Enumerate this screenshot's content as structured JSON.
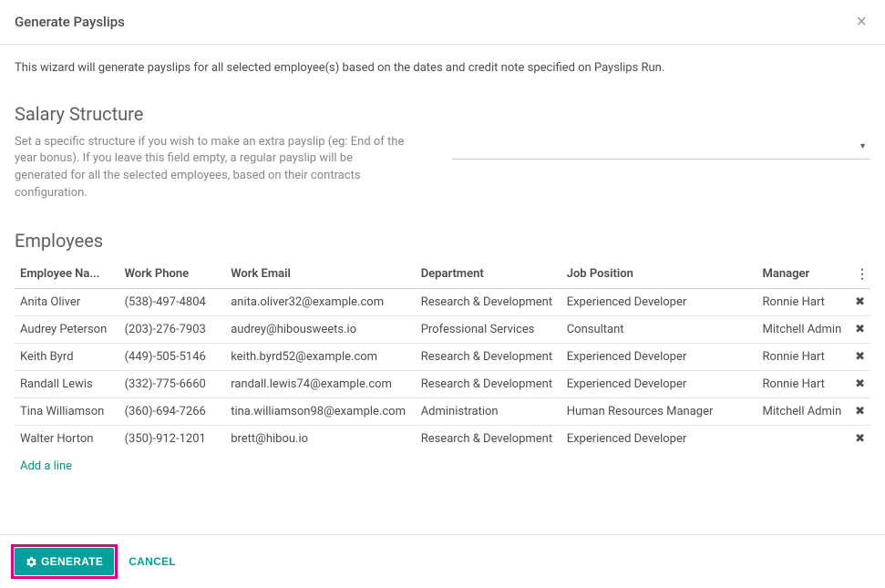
{
  "header": {
    "title": "Generate Payslips"
  },
  "body": {
    "intro": "This wizard will generate payslips for all selected employee(s) based on the dates and credit note specified on Payslips Run.",
    "salary": {
      "title": "Salary Structure",
      "description": "Set a specific structure if you wish to make an extra payslip (eg: End of the year bonus). If you leave this field empty, a regular payslip will be generated for all the selected employees, based on their contracts configuration.",
      "value": ""
    },
    "employees": {
      "title": "Employees",
      "columns": {
        "name": "Employee Na...",
        "phone": "Work Phone",
        "email": "Work Email",
        "department": "Department",
        "position": "Job Position",
        "manager": "Manager"
      },
      "rows": [
        {
          "name": "Anita Oliver",
          "phone": "(538)-497-4804",
          "email": "anita.oliver32@example.com",
          "department": "Research & Development",
          "position": "Experienced Developer",
          "manager": "Ronnie Hart"
        },
        {
          "name": "Audrey Peterson",
          "phone": "(203)-276-7903",
          "email": "audrey@hibousweets.io",
          "department": "Professional Services",
          "position": "Consultant",
          "manager": "Mitchell Admin"
        },
        {
          "name": "Keith Byrd",
          "phone": "(449)-505-5146",
          "email": "keith.byrd52@example.com",
          "department": "Research & Development",
          "position": "Experienced Developer",
          "manager": "Ronnie Hart"
        },
        {
          "name": "Randall Lewis",
          "phone": "(332)-775-6660",
          "email": "randall.lewis74@example.com",
          "department": "Research & Development",
          "position": "Experienced Developer",
          "manager": "Ronnie Hart"
        },
        {
          "name": "Tina Williamson",
          "phone": "(360)-694-7266",
          "email": "tina.williamson98@example.com",
          "department": "Administration",
          "position": "Human Resources Manager",
          "manager": "Mitchell Admin"
        },
        {
          "name": "Walter Horton",
          "phone": "(350)-912-1201",
          "email": "brett@hibou.io",
          "department": "Research & Development",
          "position": "Experienced Developer",
          "manager": ""
        }
      ],
      "add_line": "Add a line"
    }
  },
  "footer": {
    "generate": "GENERATE",
    "cancel": "CANCEL"
  }
}
